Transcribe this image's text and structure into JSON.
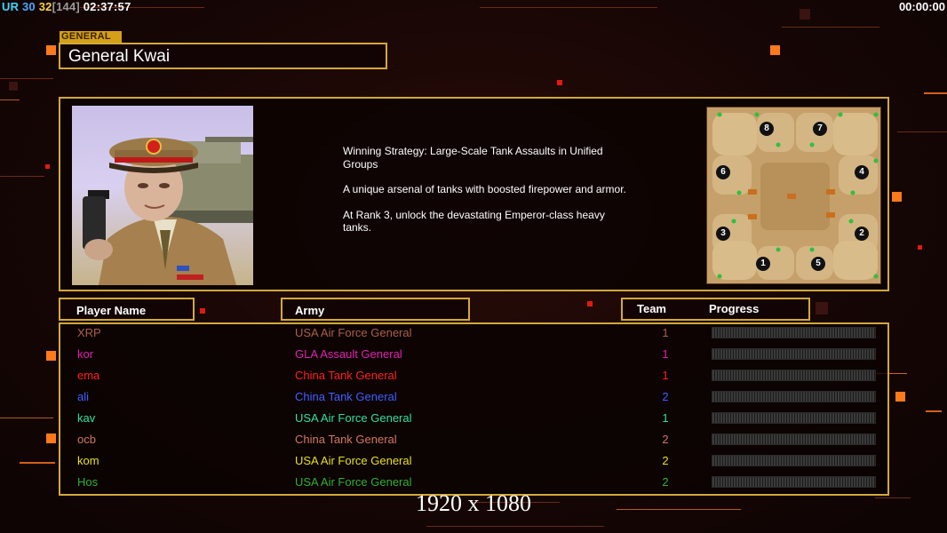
{
  "hud": {
    "ur_label": "UR",
    "fps": "30",
    "value3": "32",
    "value4": "[144]",
    "clock": "02:37:57",
    "timer": "00:00:00"
  },
  "general": {
    "tag": "GENERAL",
    "name": "General Kwai",
    "description": [
      "Winning Strategy: Large-Scale Tank Assaults in Unified Groups",
      "A unique arsenal of tanks with boosted firepower and armor.",
      "At Rank 3, unlock the devastating Emperor-class heavy tanks."
    ]
  },
  "minimap": {
    "start_positions": [
      "8",
      "7",
      "6",
      "4",
      "3",
      "2",
      "1",
      "5"
    ]
  },
  "table": {
    "headers": {
      "player": "Player Name",
      "army": "Army",
      "team": "Team",
      "progress": "Progress"
    },
    "players": [
      {
        "name": "XRP",
        "army": "USA Air Force General",
        "team": "1",
        "color": "#a8604a",
        "progress": 0
      },
      {
        "name": "kor",
        "army": "GLA Assault General",
        "team": "1",
        "color": "#e020b0",
        "progress": 0
      },
      {
        "name": "ema",
        "army": "China Tank General",
        "team": "1",
        "color": "#ff2020",
        "progress": 0
      },
      {
        "name": "ali",
        "army": "China Tank General",
        "team": "2",
        "color": "#4060ff",
        "progress": 0
      },
      {
        "name": "kav",
        "army": "USA Air Force General",
        "team": "1",
        "color": "#30e0a0",
        "progress": 0
      },
      {
        "name": "ocb",
        "army": "China Tank General",
        "team": "2",
        "color": "#d07860",
        "progress": 0
      },
      {
        "name": "kom",
        "army": "USA Air Force General",
        "team": "2",
        "color": "#e8e020",
        "progress": 0
      },
      {
        "name": "Hos",
        "army": "USA Air Force General",
        "team": "2",
        "color": "#30b030",
        "progress": 0
      }
    ]
  },
  "resolution_label": "1920 x 1080",
  "colors": {
    "frame": "#d4a83a",
    "accent_orange": "#ff7a1a",
    "background": "#160605"
  }
}
